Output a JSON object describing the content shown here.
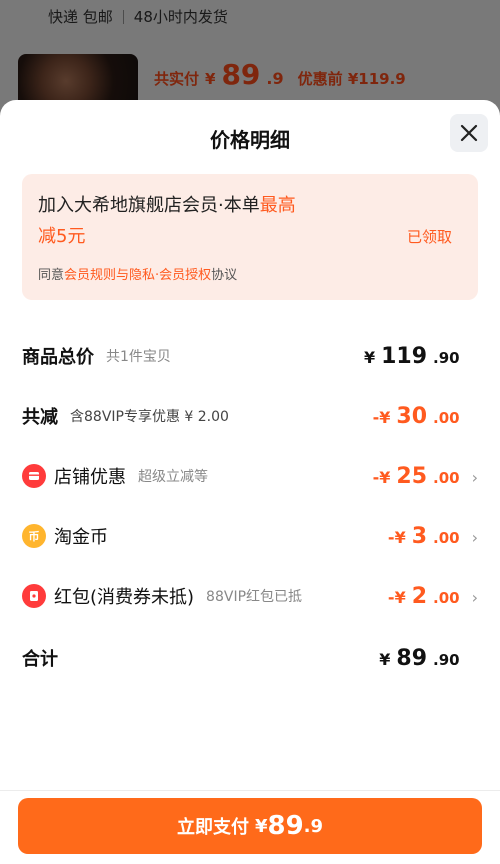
{
  "background": {
    "shipping_method": "快递 包邮",
    "shipping_time": "48小时内发货",
    "total_paid_label": "共实付",
    "total_paid_symbol": "¥",
    "total_paid_int": "89",
    "total_paid_dec": ".9",
    "before_discount": "优惠前 ¥119.9"
  },
  "sheet": {
    "title": "价格明细",
    "promo": {
      "line1_text": "加入大希地旗舰店会员·本单",
      "line1_highlight": "最高",
      "line2": "减5元",
      "claimed": "已领取",
      "agree_prefix": "同意",
      "agree_link": "会员规则与隐私·会员授权",
      "agree_suffix": "协议"
    },
    "rows": {
      "subtotal": {
        "title": "商品总价",
        "sub": "共1件宝贝",
        "yen": "¥",
        "int": "119",
        "dec": ".90"
      },
      "discount_total": {
        "title": "共减",
        "sub": "含88VIP专享优惠 ¥ 2.00",
        "yen": "-¥",
        "int": "30",
        "dec": ".00"
      },
      "shop_discount": {
        "title": "店铺优惠",
        "sub": "超级立减等",
        "yen": "-¥",
        "int": "25",
        "dec": ".00"
      },
      "tao_coin": {
        "title": "淘金币",
        "yen": "-¥",
        "int": "3",
        "dec": ".00",
        "icon_glyph": "币"
      },
      "red_packet": {
        "title": "红包(消费券未抵)",
        "sub": "88VIP红包已抵",
        "yen": "-¥",
        "int": "2",
        "dec": ".00"
      },
      "total": {
        "title": "合计",
        "yen": "¥",
        "int": "89",
        "dec": ".90"
      }
    },
    "pay_button": {
      "label": "立即支付",
      "yen": "¥",
      "int": "89",
      "dec": ".9"
    }
  },
  "colors": {
    "accent": "#ff5a1f",
    "button": "#ff6a1a",
    "promo_bg": "#fdece6",
    "icon_red": "#ff3b3b",
    "icon_gold": "#ffb52e"
  }
}
